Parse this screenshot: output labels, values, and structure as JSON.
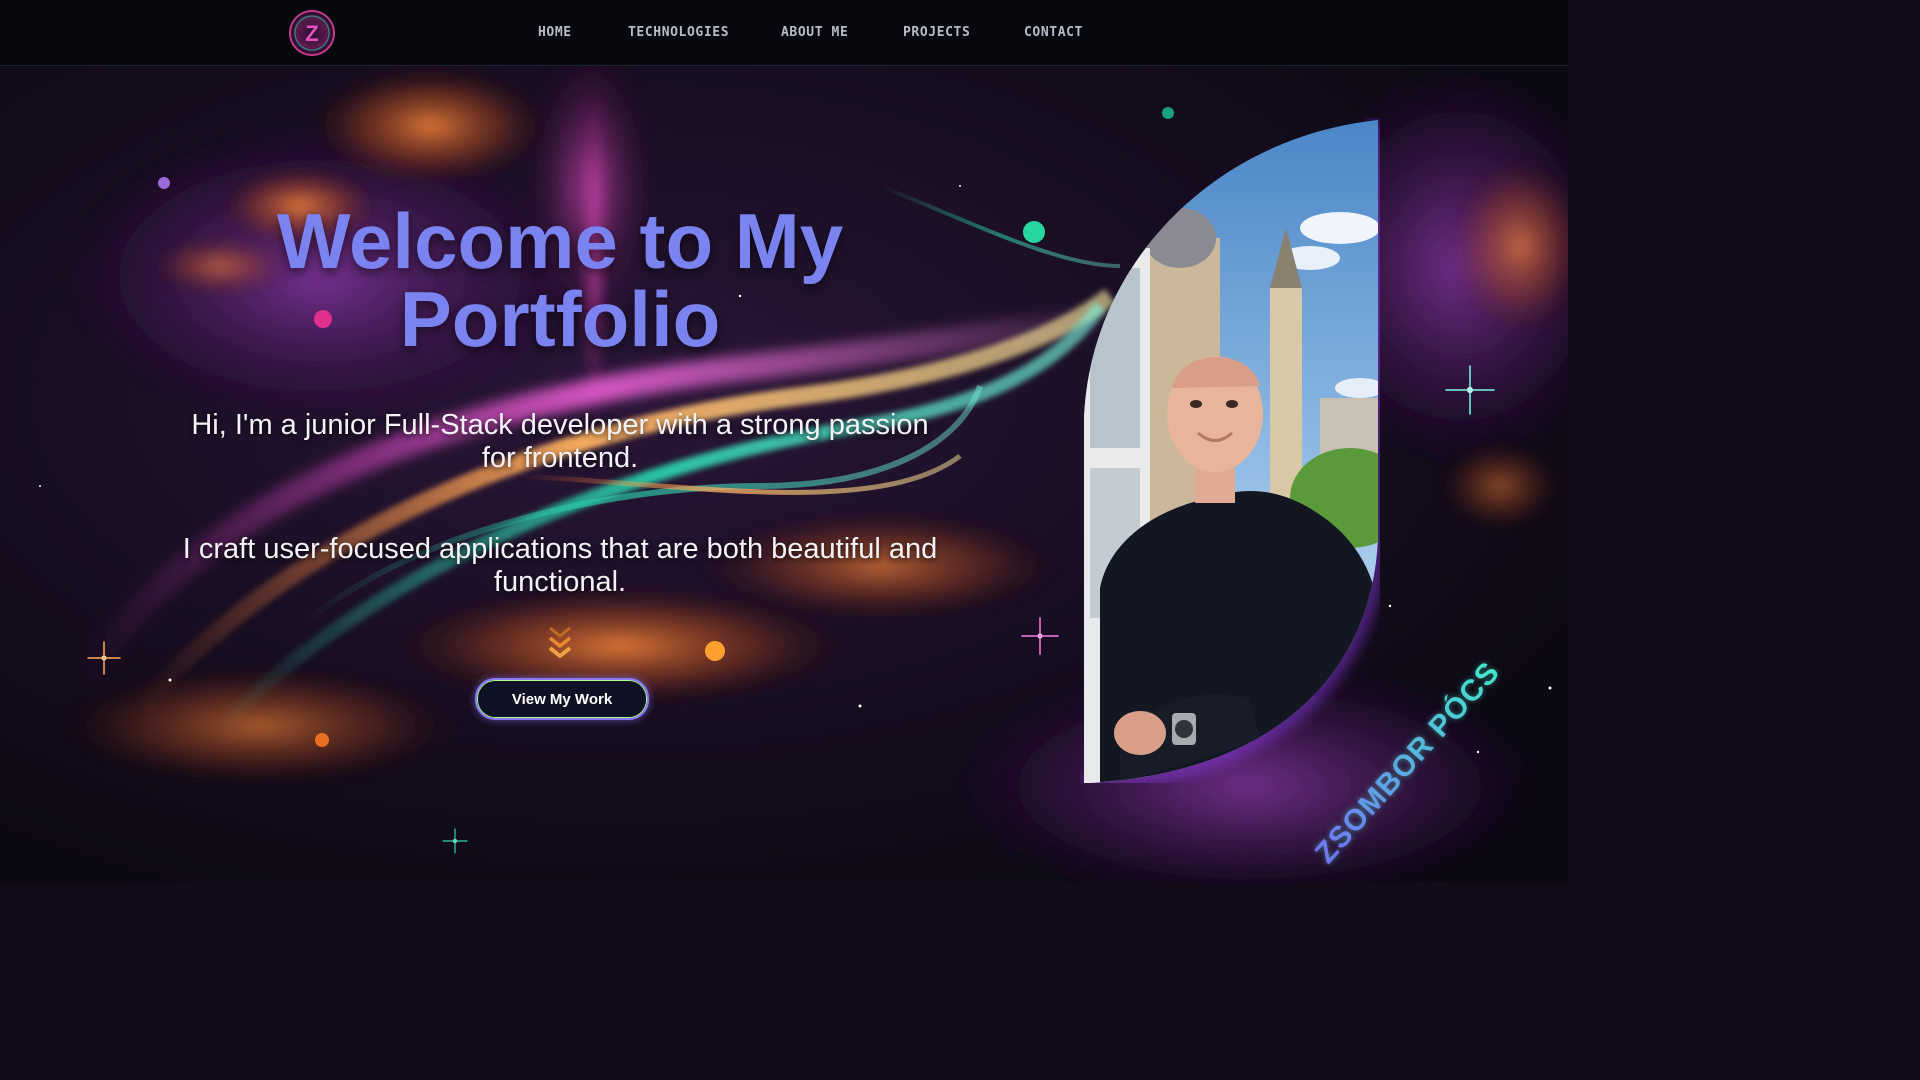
{
  "nav": {
    "logo_letter": "Z",
    "links": [
      "HOME",
      "TECHNOLOGIES",
      "ABOUT ME",
      "PROJECTS",
      "CONTACT"
    ]
  },
  "hero": {
    "title_line1": "Welcome to My",
    "title_line2": "Portfolio",
    "intro": "Hi, I'm a junior Full-Stack developer with a strong passion for frontend.",
    "craft": "I craft user-focused applications that are both beautiful and functional.",
    "cta_label": "View My Work",
    "name_tag": "ZSOMBOR PÓCS"
  },
  "colors": {
    "title": "#7b83f0",
    "nav_bg": "#07090f",
    "cta_border": "#8c77ff",
    "accent_teal": "#2ad6b0",
    "accent_orange": "#ff8a2a",
    "accent_pink": "#e03ac8"
  },
  "icons": {
    "logo": "z-logo-icon",
    "scroll": "double-chevron-down-icon"
  }
}
